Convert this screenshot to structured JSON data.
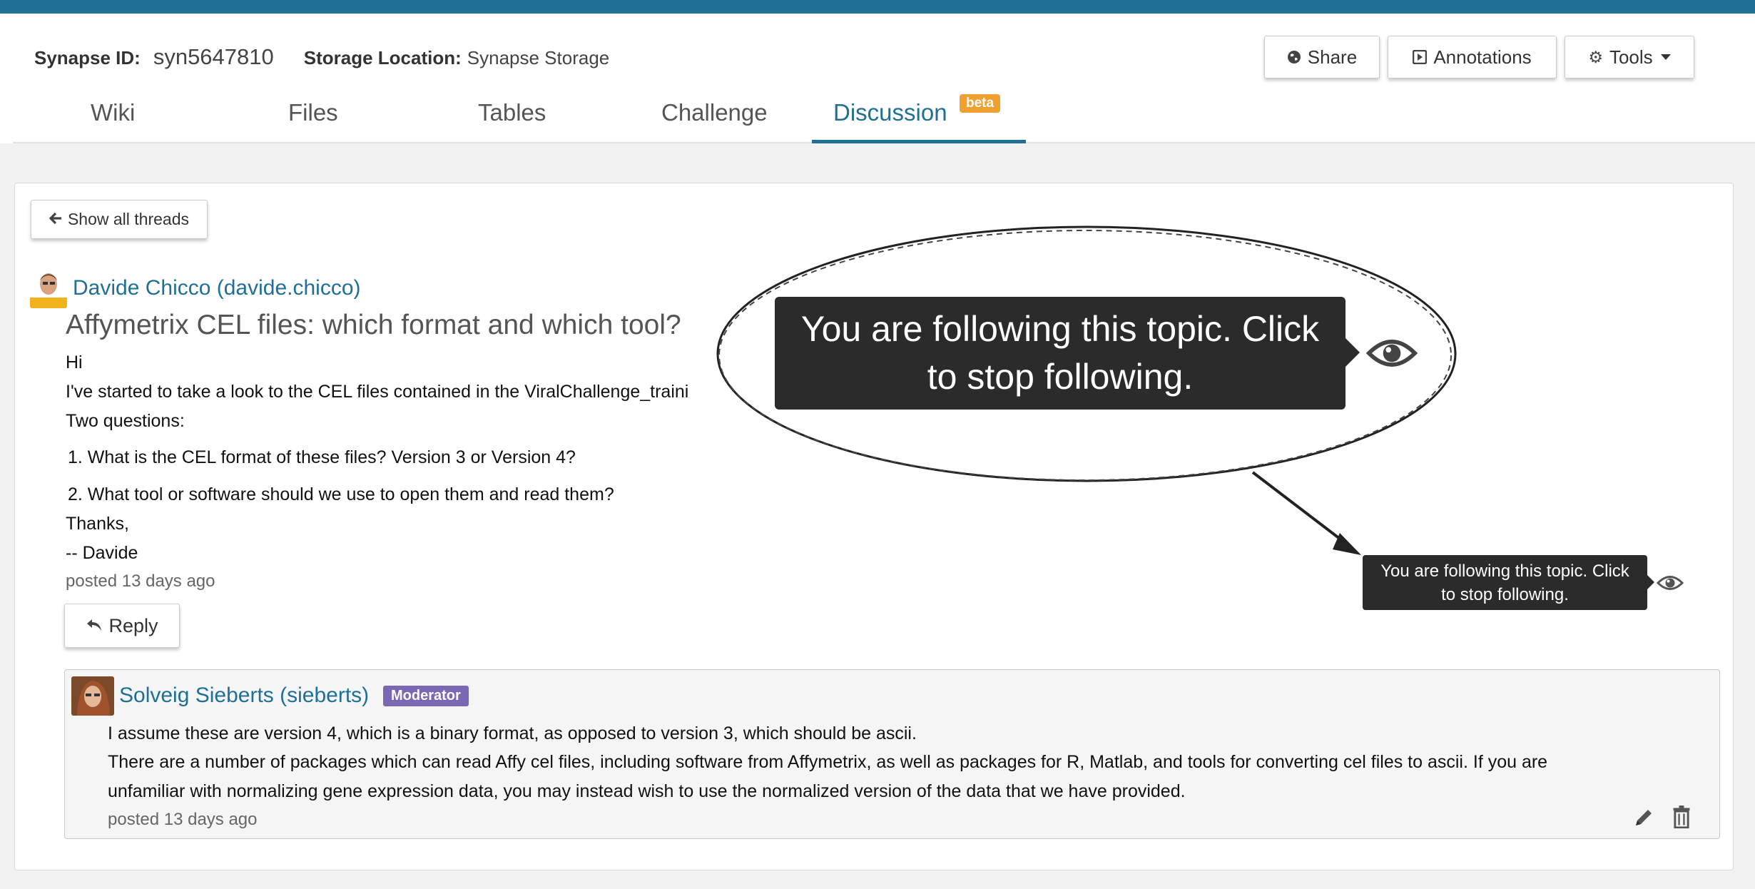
{
  "header": {
    "synapse_id_label": "Synapse ID:",
    "synapse_id_value": "syn5647810",
    "storage_label": "Storage Location:",
    "storage_value": "Synapse Storage",
    "share_label": "Share",
    "annotations_label": "Annotations",
    "tools_label": "Tools"
  },
  "tabs": [
    {
      "label": "Wiki"
    },
    {
      "label": "Files"
    },
    {
      "label": "Tables"
    },
    {
      "label": "Challenge"
    },
    {
      "label": "Discussion",
      "active": true,
      "badge": "beta"
    }
  ],
  "thread": {
    "show_all_label": "Show all threads",
    "author": "Davide Chicco (davide.chicco)",
    "title": "Affymetrix CEL files: which format and which tool?",
    "body": [
      "Hi",
      "I've started to take a look to the CEL files contained in the ViralChallenge_traini",
      "Two questions:",
      "1. What is the CEL format of these files? Version 3 or Version 4?",
      "2. What tool or software should we use to open them and read them?",
      "Thanks,",
      "-- Davide"
    ],
    "posted": "posted 13 days ago",
    "reply_label": "Reply"
  },
  "tooltip": {
    "text_line1": "You are following this topic. Click",
    "text_line2": "to stop following."
  },
  "reply": {
    "author": "Solveig Sieberts (sieberts)",
    "badge": "Moderator",
    "body": [
      "I assume these are version 4, which is a binary format, as opposed to version 3, which should be ascii.",
      "There are a number of packages which can read Affy cel files, including software from Affymetrix, as well as packages for R, Matlab, and tools for converting cel files to ascii. If you are",
      "unfamiliar with normalizing gene expression data, you may instead wish to use the normalized version of the data that we have provided."
    ],
    "posted": "posted 13 days ago"
  },
  "icons": {
    "share": "globe-icon",
    "annotations": "play-square-icon",
    "tools": "gear-icon",
    "back": "arrow-left-icon",
    "reply": "reply-icon",
    "follow": "eye-icon",
    "pin": "pin-icon",
    "delete": "trash-icon",
    "edit": "pencil-icon"
  },
  "colors": {
    "brand": "#1f6f96",
    "beta_badge": "#f0a030",
    "moderator_badge": "#7b68b5",
    "tooltip_bg": "#2b2b2b"
  }
}
